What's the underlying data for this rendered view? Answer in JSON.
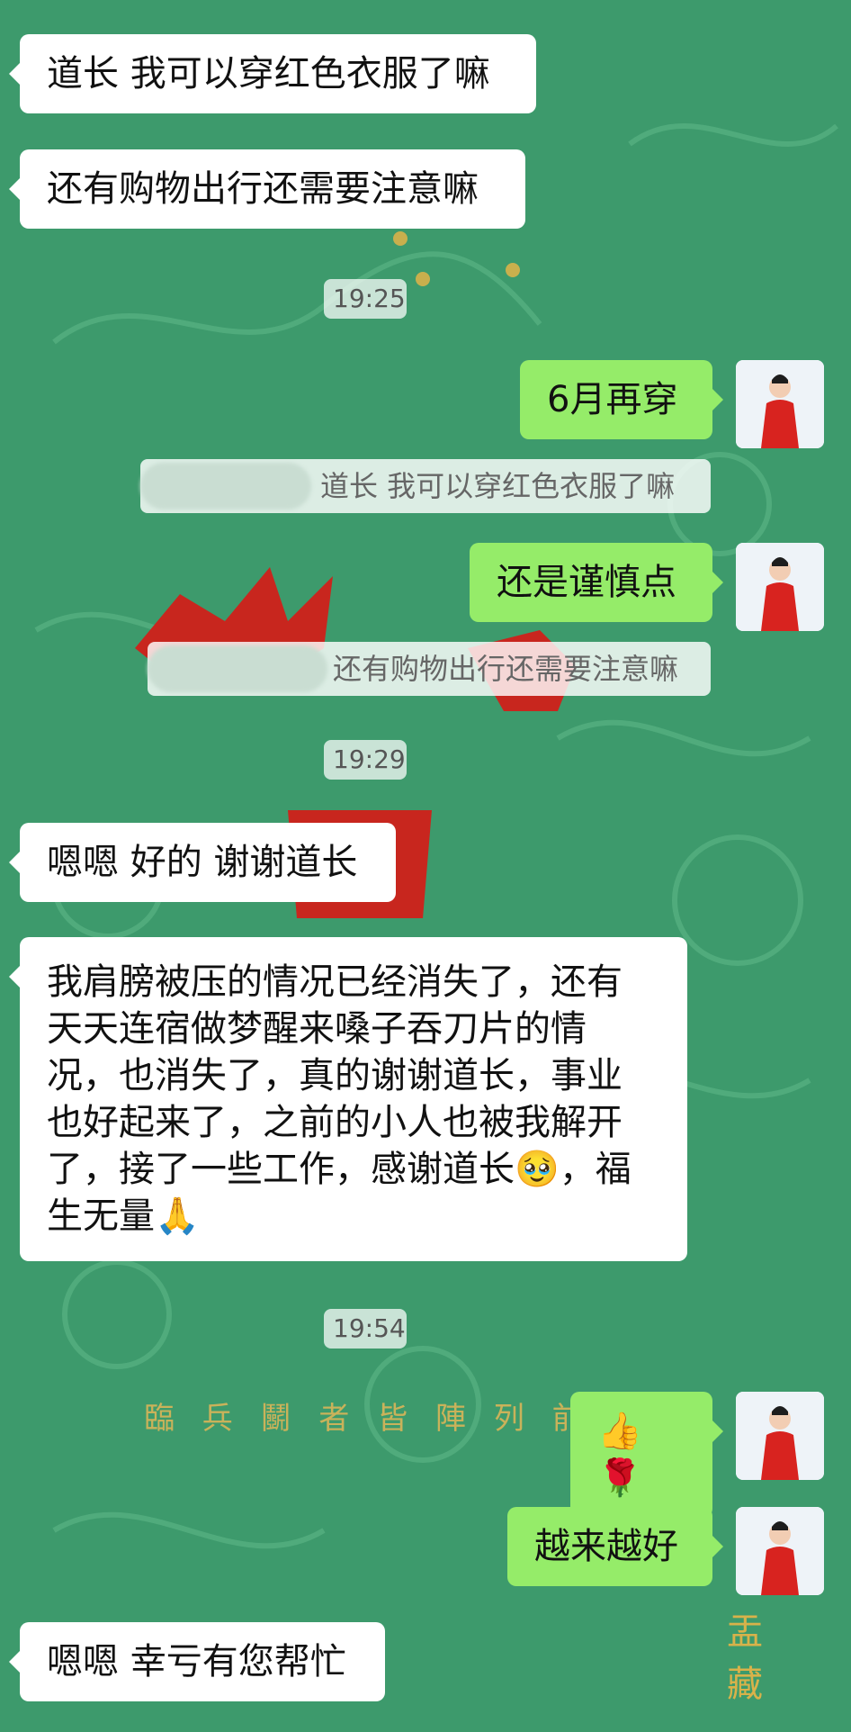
{
  "colors": {
    "background": "#3d9a6c",
    "incoming_bubble": "#ffffff",
    "outgoing_bubble": "#95ec69",
    "text": "#111111",
    "timestamp_text": "#555555"
  },
  "background_text": {
    "spell_line": "臨 兵 鬭 者 皆 陣 列 前 行",
    "corner_text": "盂 藏"
  },
  "messages": {
    "m1": "道长 我可以穿红色衣服了嘛",
    "m2": "还有购物出行还需要注意嘛",
    "t1": "19:25",
    "m3": "6月再穿",
    "q1": "道长 我可以穿红色衣服了嘛",
    "m4": "还是谨慎点",
    "q2": "还有购物出行还需要注意嘛",
    "t2": "19:29",
    "m5": "嗯嗯 好的 谢谢道长",
    "m6_l1": "我肩膀被压的情况已经消失了，还有",
    "m6_l2": "天天连宿做梦醒来嗓子吞刀片的情",
    "m6_l3": "况，也消失了，真的谢谢道长，事业",
    "m6_l4": "也好起来了，之前的小人也被我解开",
    "m6_l5a": "了，接了一些工作，感谢道长",
    "m6_emoji1": "🥹",
    "m6_l5b": "，福",
    "m6_l6": "生无量",
    "m6_emoji2": "🙏",
    "t3": "19:54",
    "m7": "👍🌹",
    "m8": "越来越好",
    "m9": "嗯嗯 幸亏有您帮忙"
  }
}
